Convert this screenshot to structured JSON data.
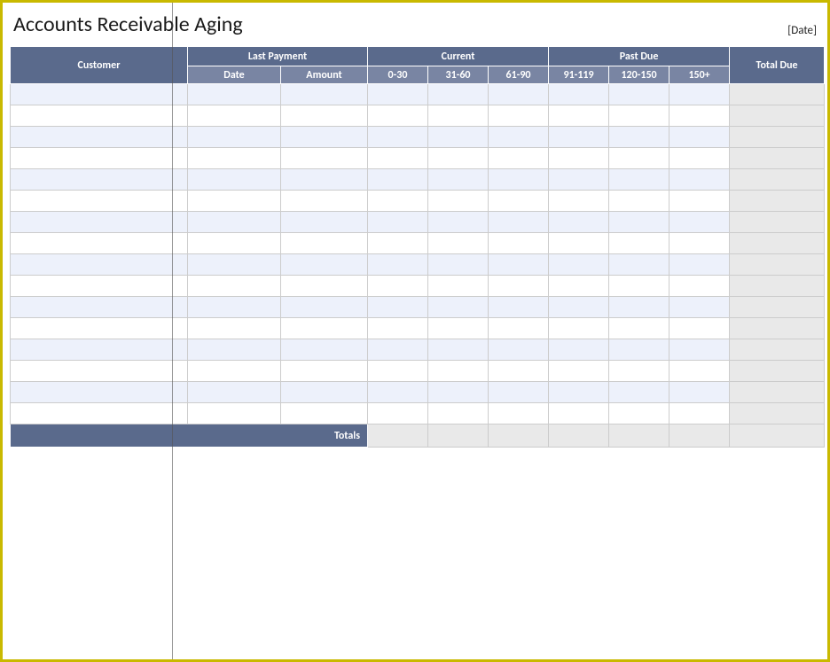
{
  "title": "Accounts Receivable Aging",
  "date_placeholder": "[Date]",
  "headers": {
    "customer": "Customer",
    "last_payment": "Last Payment",
    "current_group": "Current",
    "past_due_group": "Past Due",
    "total_due": "Total Due",
    "date": "Date",
    "amount": "Amount",
    "b0_30": "0-30",
    "b31_60": "31-60",
    "b61_90": "61-90",
    "b91_119": "91-119",
    "b120_150": "120-150",
    "b150p": "150+"
  },
  "totals_label": "Totals",
  "rows": [
    {
      "customer": "",
      "date": "",
      "amount": "",
      "b0_30": "",
      "b31_60": "",
      "b61_90": "",
      "b91_119": "",
      "b120_150": "",
      "b150p": "",
      "total": ""
    },
    {
      "customer": "",
      "date": "",
      "amount": "",
      "b0_30": "",
      "b31_60": "",
      "b61_90": "",
      "b91_119": "",
      "b120_150": "",
      "b150p": "",
      "total": ""
    },
    {
      "customer": "",
      "date": "",
      "amount": "",
      "b0_30": "",
      "b31_60": "",
      "b61_90": "",
      "b91_119": "",
      "b120_150": "",
      "b150p": "",
      "total": ""
    },
    {
      "customer": "",
      "date": "",
      "amount": "",
      "b0_30": "",
      "b31_60": "",
      "b61_90": "",
      "b91_119": "",
      "b120_150": "",
      "b150p": "",
      "total": ""
    },
    {
      "customer": "",
      "date": "",
      "amount": "",
      "b0_30": "",
      "b31_60": "",
      "b61_90": "",
      "b91_119": "",
      "b120_150": "",
      "b150p": "",
      "total": ""
    },
    {
      "customer": "",
      "date": "",
      "amount": "",
      "b0_30": "",
      "b31_60": "",
      "b61_90": "",
      "b91_119": "",
      "b120_150": "",
      "b150p": "",
      "total": ""
    },
    {
      "customer": "",
      "date": "",
      "amount": "",
      "b0_30": "",
      "b31_60": "",
      "b61_90": "",
      "b91_119": "",
      "b120_150": "",
      "b150p": "",
      "total": ""
    },
    {
      "customer": "",
      "date": "",
      "amount": "",
      "b0_30": "",
      "b31_60": "",
      "b61_90": "",
      "b91_119": "",
      "b120_150": "",
      "b150p": "",
      "total": ""
    },
    {
      "customer": "",
      "date": "",
      "amount": "",
      "b0_30": "",
      "b31_60": "",
      "b61_90": "",
      "b91_119": "",
      "b120_150": "",
      "b150p": "",
      "total": ""
    },
    {
      "customer": "",
      "date": "",
      "amount": "",
      "b0_30": "",
      "b31_60": "",
      "b61_90": "",
      "b91_119": "",
      "b120_150": "",
      "b150p": "",
      "total": ""
    },
    {
      "customer": "",
      "date": "",
      "amount": "",
      "b0_30": "",
      "b31_60": "",
      "b61_90": "",
      "b91_119": "",
      "b120_150": "",
      "b150p": "",
      "total": ""
    },
    {
      "customer": "",
      "date": "",
      "amount": "",
      "b0_30": "",
      "b31_60": "",
      "b61_90": "",
      "b91_119": "",
      "b120_150": "",
      "b150p": "",
      "total": ""
    },
    {
      "customer": "",
      "date": "",
      "amount": "",
      "b0_30": "",
      "b31_60": "",
      "b61_90": "",
      "b91_119": "",
      "b120_150": "",
      "b150p": "",
      "total": ""
    },
    {
      "customer": "",
      "date": "",
      "amount": "",
      "b0_30": "",
      "b31_60": "",
      "b61_90": "",
      "b91_119": "",
      "b120_150": "",
      "b150p": "",
      "total": ""
    },
    {
      "customer": "",
      "date": "",
      "amount": "",
      "b0_30": "",
      "b31_60": "",
      "b61_90": "",
      "b91_119": "",
      "b120_150": "",
      "b150p": "",
      "total": ""
    },
    {
      "customer": "",
      "date": "",
      "amount": "",
      "b0_30": "",
      "b31_60": "",
      "b61_90": "",
      "b91_119": "",
      "b120_150": "",
      "b150p": "",
      "total": ""
    }
  ],
  "totals": {
    "b0_30": "",
    "b31_60": "",
    "b61_90": "",
    "b91_119": "",
    "b120_150": "",
    "b150p": "",
    "total": ""
  }
}
